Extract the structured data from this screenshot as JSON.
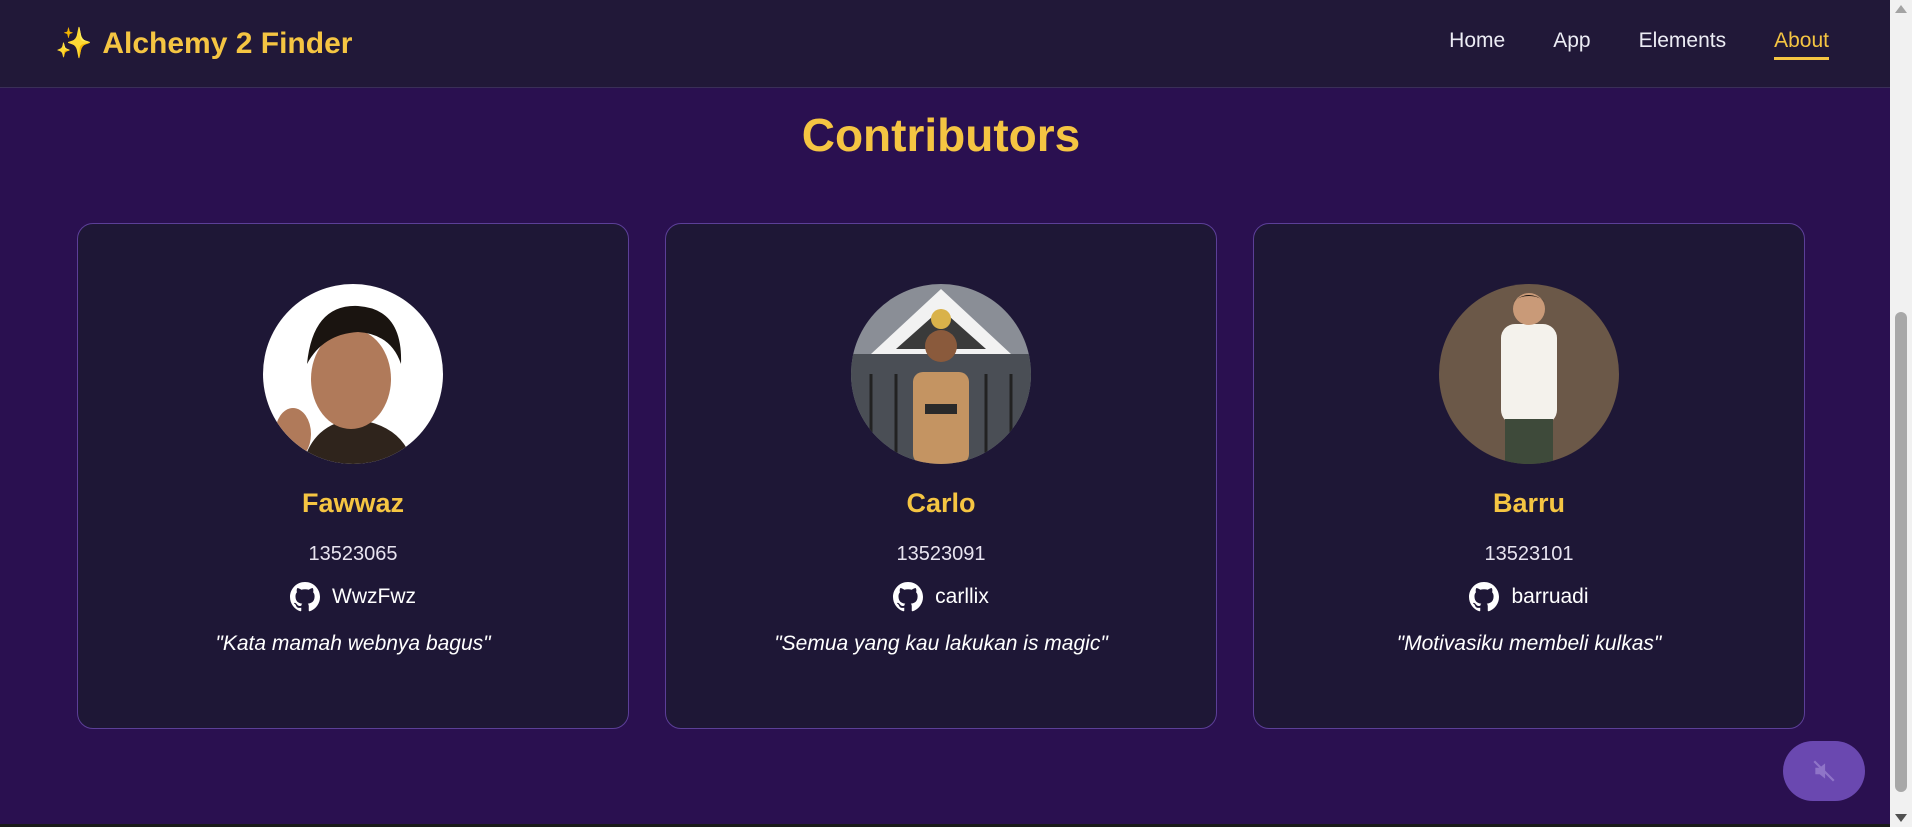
{
  "navbar": {
    "brand_icon": "sparkles-icon",
    "brand_emoji": "✨",
    "brand_title": "Alchemy 2 Finder",
    "links": [
      {
        "label": "Home",
        "active": false
      },
      {
        "label": "App",
        "active": false
      },
      {
        "label": "Elements",
        "active": false
      },
      {
        "label": "About",
        "active": true
      }
    ]
  },
  "main": {
    "title": "Contributors",
    "contributors": [
      {
        "name": "Fawwaz",
        "nim": "13523065",
        "github_icon": "github-icon",
        "github": "WwzFwz",
        "quote": "\"Kata mamah webnya bagus\""
      },
      {
        "name": "Carlo",
        "nim": "13523091",
        "github_icon": "github-icon",
        "github": "carllix",
        "quote": "\"Semua yang kau lakukan is magic\""
      },
      {
        "name": "Barru",
        "nim": "13523101",
        "github_icon": "github-icon",
        "github": "barruadi",
        "quote": "\"Motivasiku membeli kulkas\""
      }
    ]
  },
  "mute_button": {
    "icon": "speaker-muted-icon"
  },
  "colors": {
    "background": "#2a1050",
    "navbar": "#211838",
    "accent": "#f5c542",
    "card": "#1e1736",
    "card_border": "#5c3f98",
    "button": "#6a48b0"
  }
}
